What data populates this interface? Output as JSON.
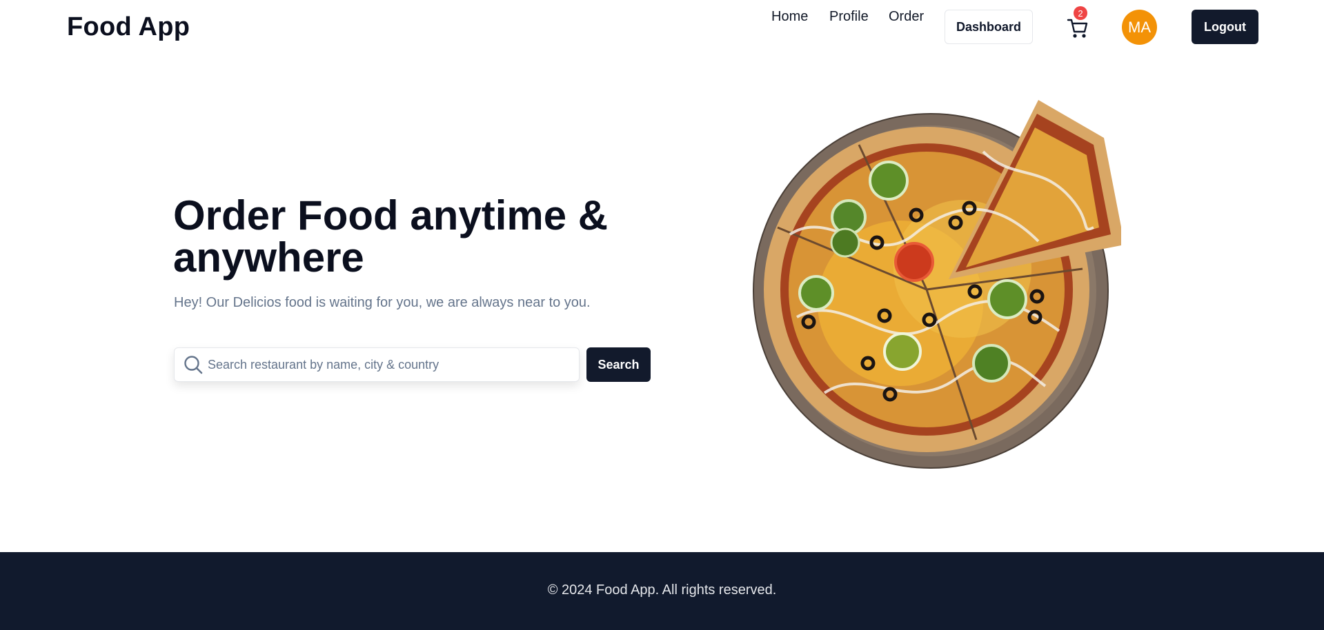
{
  "header": {
    "logo": "Food App",
    "nav": {
      "home": "Home",
      "profile": "Profile",
      "order": "Order",
      "dashboard": "Dashboard",
      "logout": "Logout"
    },
    "cart": {
      "count": "2",
      "icon": "cart-icon"
    },
    "avatar": {
      "initials": "MA",
      "color": "#f39207"
    }
  },
  "hero": {
    "title": "Order Food anytime & anywhere",
    "subtitle": "Hey! Our Delicios food is waiting for you, we are always near to you.",
    "search": {
      "placeholder": "Search restaurant by name, city & country",
      "value": "",
      "button": "Search",
      "icon": "search-icon"
    },
    "image": "pizza-image"
  },
  "footer": {
    "text": "© 2024 Food App. All rights reserved.",
    "background": "#111a2d"
  },
  "colors": {
    "primary_dark": "#121a2c",
    "badge": "#ef4444",
    "muted_text": "#64748b"
  }
}
